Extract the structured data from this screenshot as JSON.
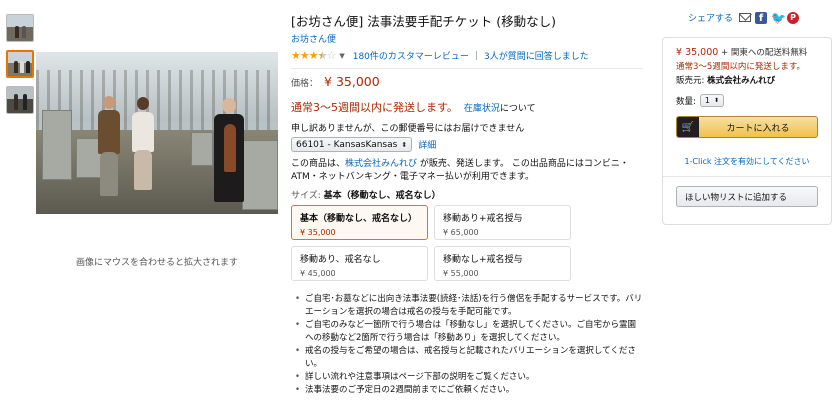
{
  "gallery": {
    "zoom_hint": "画像にマウスを合わせると拡大されます"
  },
  "product": {
    "title": "[お坊さん便] 法事法要手配チケット (移動なし)",
    "brand": "お坊さん便",
    "rating_out_of_5": 3.5,
    "reviews_link": "180件のカスタマーレビュー",
    "answers_link": "3人が質問に回答しました",
    "price_label": "価格：",
    "price": "¥ 35,000",
    "ship_time": "通常3～5週間以内に発送します。",
    "stock_link": "在庫状況",
    "stock_suffix": "について",
    "zip_message": "申し訳ありませんが、この郵便番号にはお届けできません",
    "zip_value": "66101 - KansasKansas",
    "zip_detail": "詳細",
    "seller_prefix": "この商品は、",
    "seller_name": "株式会社みんれび",
    "seller_suffix": " が販売、発送します。 この出品商品にはコンビニ・ATM・ネットバンキング・電子マネー払いが利用できます。",
    "size_label": "サイズ:",
    "size_value": "基本（移動なし、戒名なし）",
    "variants": [
      {
        "name": "基本（移動なし、戒名なし）",
        "price": "¥ 35,000"
      },
      {
        "name": "移動あり+戒名授与",
        "price": "¥ 65,000"
      },
      {
        "name": "移動あり、戒名なし",
        "price": "¥ 45,000"
      },
      {
        "name": "移動なし+戒名授与",
        "price": "¥ 55,000"
      }
    ],
    "bullets": [
      "ご自宅･お墓などに出向き法事法要(読経･法話)を行う僧侶を手配するサービスです。バリエーションを選択の場合は戒名の授与を手配可能です。",
      "ご自宅のみなど一箇所で行う場合は「移動なし」を選択してください。ご自宅から霊園への移動など2箇所で行う場合は「移動あり」を選択してください。",
      "戒名の授与をご希望の場合は、戒名授与と記載されたバリエーションを選択してください。",
      "詳しい流れや注意事項はページ下部の説明をご覧ください。",
      "法事法要のご予定日の2週間前までにご依頼ください。"
    ]
  },
  "share": {
    "label": "シェアする",
    "icons": [
      "mail-icon",
      "facebook-icon",
      "twitter-icon",
      "pinterest-icon"
    ],
    "fb_glyph": "f",
    "tw_glyph": "🐦",
    "pin_glyph": "P"
  },
  "buybox": {
    "price": "¥ 35,000",
    "shipping_note": "+ 関東への配送料無料",
    "ship_time": "通常3～5週間以内に発送します。",
    "seller_label": "販売元:",
    "seller_name": "株式会社みんれび",
    "qty_label": "数量:",
    "qty_value": "1",
    "cart_button": "カートに入れる",
    "one_click": "1-Click 注文を有効にしてください",
    "wishlist_button": "ほしい物リストに追加する"
  },
  "colors": {
    "price": "#b12704",
    "link": "#0066c0",
    "selected_border": "#e77600",
    "cart_button": "#f0c14b"
  }
}
